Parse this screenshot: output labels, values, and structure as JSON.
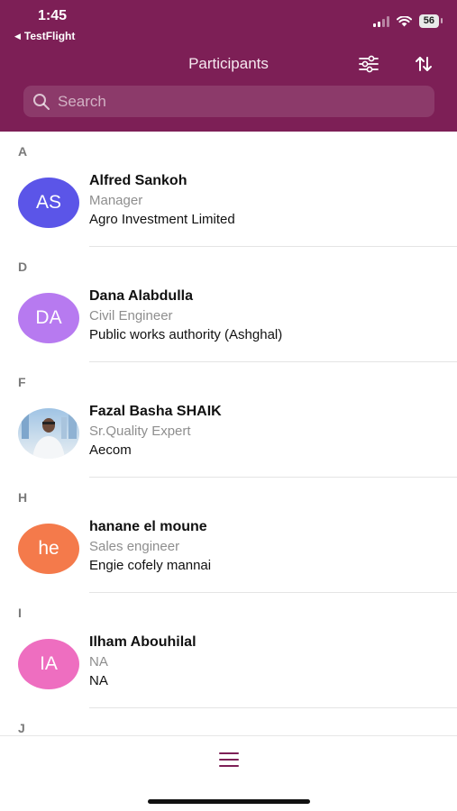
{
  "status_bar": {
    "time": "1:45",
    "back_app": "TestFlight",
    "battery": "56"
  },
  "header": {
    "title": "Participants",
    "filter_icon": "sliders-icon",
    "sort_icon": "sort-arrows-icon"
  },
  "search": {
    "placeholder": "Search",
    "value": ""
  },
  "colors": {
    "header_bg": "#7d1f56",
    "accent": "#7d1f56"
  },
  "sections": [
    {
      "letter": "A",
      "participants": [
        {
          "initials": "AS",
          "name": "Alfred Sankoh",
          "role": "Manager",
          "company": "Agro Investment Limited",
          "avatar_color": "#5b55e8"
        }
      ]
    },
    {
      "letter": "D",
      "participants": [
        {
          "initials": "DA",
          "name": "Dana Alabdulla",
          "role": "Civil Engineer",
          "company": "Public works authority (Ashghal)",
          "avatar_color": "#b77af0"
        }
      ]
    },
    {
      "letter": "F",
      "participants": [
        {
          "initials": "",
          "name": "Fazal Basha SHAIK",
          "role": "Sr.Quality Expert",
          "company": "Aecom",
          "avatar_color": "photo"
        }
      ]
    },
    {
      "letter": "H",
      "participants": [
        {
          "initials": "he",
          "name": "hanane el moune",
          "role": "Sales engineer",
          "company": "Engie cofely mannai",
          "avatar_color": "#f47a4b"
        }
      ]
    },
    {
      "letter": "I",
      "participants": [
        {
          "initials": "IA",
          "name": "Ilham Abouhilal",
          "role": "NA",
          "company": "NA",
          "avatar_color": "#ee6ec0"
        }
      ]
    },
    {
      "letter": "J",
      "participants": []
    }
  ],
  "bottom_bar": {
    "menu_icon": "hamburger-menu-icon"
  }
}
